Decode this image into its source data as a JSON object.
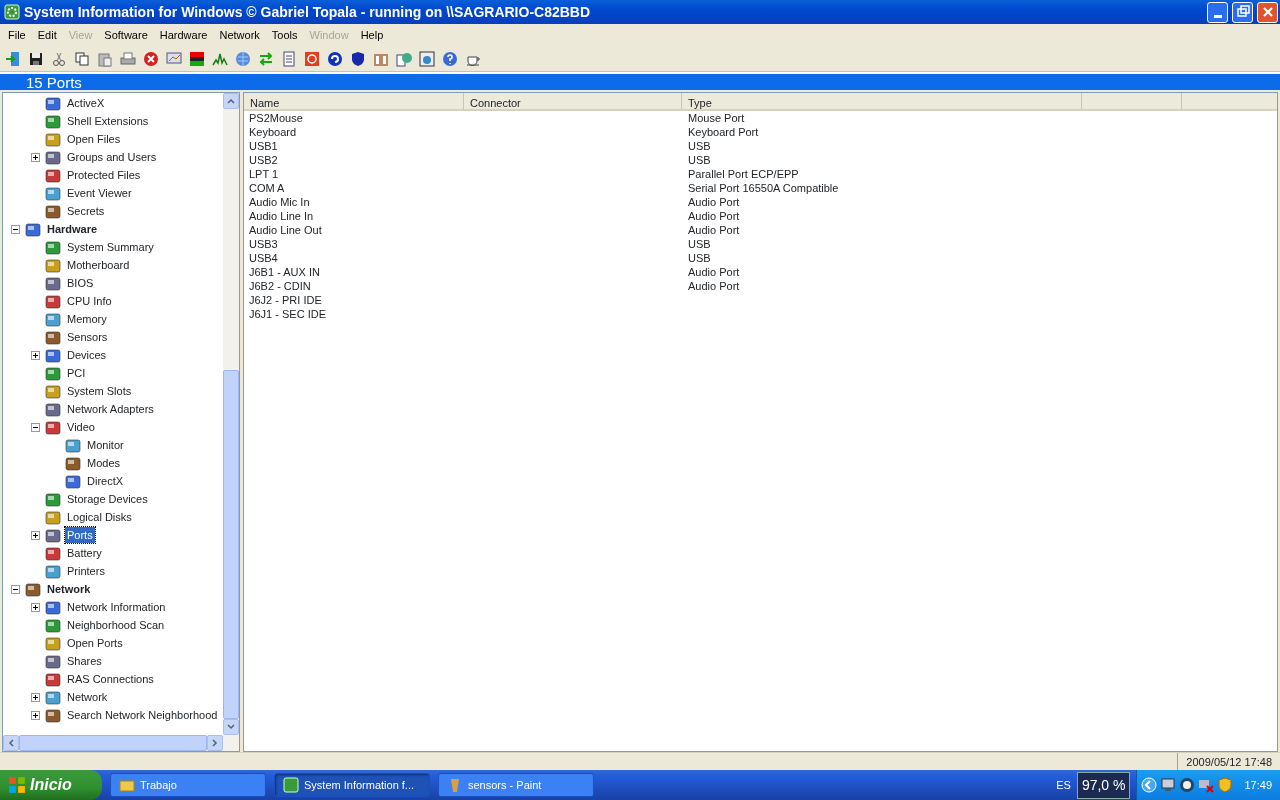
{
  "window": {
    "title": "System Information for Windows  © Gabriel Topala - running on \\\\SAGRARIO-C82BBD"
  },
  "menu": [
    {
      "label": "File",
      "disabled": false
    },
    {
      "label": "Edit",
      "disabled": false
    },
    {
      "label": "View",
      "disabled": true
    },
    {
      "label": "Software",
      "disabled": false
    },
    {
      "label": "Hardware",
      "disabled": false
    },
    {
      "label": "Network",
      "disabled": false
    },
    {
      "label": "Tools",
      "disabled": false
    },
    {
      "label": "Window",
      "disabled": true
    },
    {
      "label": "Help",
      "disabled": false
    }
  ],
  "section_header": "15 Ports",
  "tree": {
    "continued_items": [
      {
        "label": "ActiveX",
        "selected": false
      },
      {
        "label": "Shell Extensions",
        "selected": false
      },
      {
        "label": "Open Files",
        "selected": false
      },
      {
        "label": "Groups and Users",
        "selected": false,
        "expanded": false
      },
      {
        "label": "Protected Files",
        "selected": false
      },
      {
        "label": "Event Viewer",
        "selected": false
      },
      {
        "label": "Secrets",
        "selected": false
      }
    ],
    "items": [
      {
        "label": "Hardware",
        "selected": false,
        "expanded": true,
        "children": [
          {
            "label": "System Summary",
            "selected": false
          },
          {
            "label": "Motherboard",
            "selected": false
          },
          {
            "label": "BIOS",
            "selected": false
          },
          {
            "label": "CPU Info",
            "selected": false
          },
          {
            "label": "Memory",
            "selected": false
          },
          {
            "label": "Sensors",
            "selected": false
          },
          {
            "label": "Devices",
            "selected": false,
            "expanded": false
          },
          {
            "label": "PCI",
            "selected": false
          },
          {
            "label": "System Slots",
            "selected": false
          },
          {
            "label": "Network Adapters",
            "selected": false
          },
          {
            "label": "Video",
            "selected": false,
            "expanded": true,
            "children": [
              {
                "label": "Monitor",
                "selected": false
              },
              {
                "label": "Modes",
                "selected": false
              },
              {
                "label": "DirectX",
                "selected": false
              }
            ]
          },
          {
            "label": "Storage Devices",
            "selected": false
          },
          {
            "label": "Logical Disks",
            "selected": false
          },
          {
            "label": "Ports",
            "selected": true,
            "expanded": false
          },
          {
            "label": "Battery",
            "selected": false
          },
          {
            "label": "Printers",
            "selected": false
          }
        ]
      },
      {
        "label": "Network",
        "selected": false,
        "expanded": true,
        "children": [
          {
            "label": "Network Information",
            "selected": false,
            "expanded": false
          },
          {
            "label": "Neighborhood Scan",
            "selected": false
          },
          {
            "label": "Open Ports",
            "selected": false
          },
          {
            "label": "Shares",
            "selected": false
          },
          {
            "label": "RAS Connections",
            "selected": false
          },
          {
            "label": "Network",
            "selected": false,
            "expanded": false
          },
          {
            "label": "Search Network Neighborhood",
            "selected": false,
            "expanded": false
          }
        ]
      }
    ]
  },
  "table": {
    "columns": [
      "Name",
      "Connector",
      "Type"
    ],
    "rows": [
      {
        "name": "PS2Mouse",
        "type": "Mouse Port"
      },
      {
        "name": "Keyboard",
        "type": "Keyboard Port"
      },
      {
        "name": "USB1",
        "type": "USB"
      },
      {
        "name": "USB2",
        "type": "USB"
      },
      {
        "name": "LPT 1",
        "type": "Parallel Port ECP/EPP"
      },
      {
        "name": "COM A",
        "type": "Serial Port 16550A Compatible"
      },
      {
        "name": "Audio Mic In",
        "type": "Audio Port"
      },
      {
        "name": "Audio Line In",
        "type": "Audio Port"
      },
      {
        "name": "Audio Line Out",
        "type": "Audio Port"
      },
      {
        "name": "USB3",
        "type": "USB"
      },
      {
        "name": "USB4",
        "type": "USB"
      },
      {
        "name": "J6B1 - AUX IN",
        "type": "Audio Port"
      },
      {
        "name": "J6B2 - CDIN",
        "type": "Audio Port"
      },
      {
        "name": "J6J2 - PRI IDE"
      },
      {
        "name": "J6J1 - SEC IDE"
      }
    ]
  },
  "status_bar": {
    "datetime": "2009/05/12 17:48"
  },
  "taskbar": {
    "start": "Inicio",
    "tasks": [
      {
        "label": "Trabajo",
        "selected": false
      },
      {
        "label": "System Information f...",
        "selected": true
      },
      {
        "label": "sensors - Paint",
        "selected": false
      }
    ],
    "language": "ES",
    "meter": "97,0 %",
    "clock": "17:49"
  }
}
